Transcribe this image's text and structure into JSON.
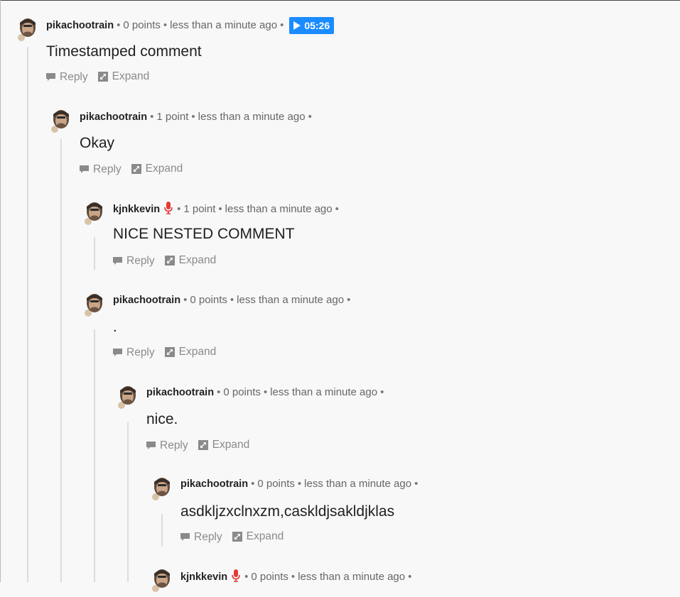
{
  "common": {
    "reply_label": "Reply",
    "expand_label": "Expand",
    "separator": "•"
  },
  "comments": [
    {
      "author": "pikachootrain",
      "points": "0 points",
      "time": "less than a minute ago",
      "timestamp": "05:26",
      "text": "Timestamped comment",
      "mic": false
    },
    {
      "author": "pikachootrain",
      "points": "1 point",
      "time": "less than a minute ago",
      "text": "Okay",
      "mic": false
    },
    {
      "author": "kjnkkevin",
      "points": "1 point",
      "time": "less than a minute ago",
      "text": "NICE NESTED COMMENT",
      "mic": true
    },
    {
      "author": "pikachootrain",
      "points": "0 points",
      "time": "less than a minute ago",
      "text": ".",
      "mic": false
    },
    {
      "author": "pikachootrain",
      "points": "0 points",
      "time": "less than a minute ago",
      "text": "nice.",
      "mic": false
    },
    {
      "author": "pikachootrain",
      "points": "0 points",
      "time": "less than a minute ago",
      "text": "asdkljzxclnxzm,caskldjsakldjklas",
      "mic": false
    },
    {
      "author": "kjnkkevin",
      "points": "0 points",
      "time": "less than a minute ago",
      "mic": true
    }
  ],
  "colors": {
    "timestamp_badge": "#1a8cff",
    "mic_icon": "#e53935",
    "thread_line": "#dcdcdc"
  }
}
